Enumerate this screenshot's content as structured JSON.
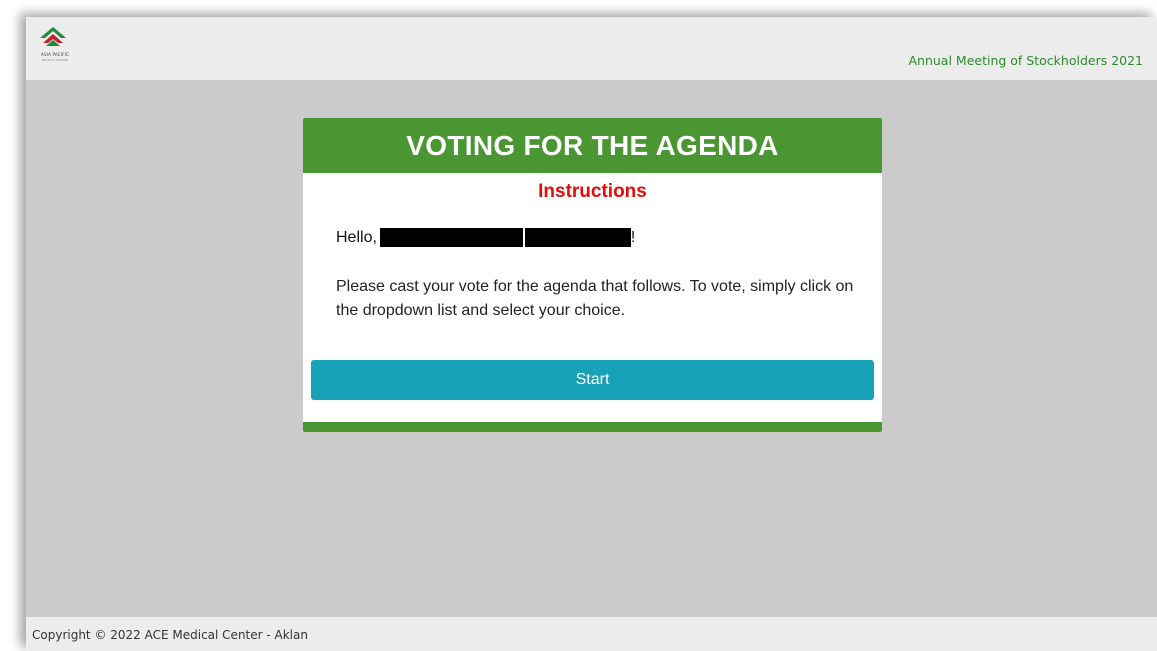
{
  "header": {
    "logo_name": "ASIA PACIFIC",
    "logo_subtitle": "MEDICAL CENTER",
    "meeting_title": "Annual Meeting of Stockholders 2021"
  },
  "card": {
    "title": "VOTING FOR THE AGENDA",
    "instructions_heading": "Instructions",
    "greeting_prefix": "Hello,",
    "greeting_suffix": "!",
    "message": "Please cast your vote for the agenda that follows. To vote, simply click on the dropdown list and select your choice.",
    "start_label": "Start"
  },
  "footer": {
    "copyright": "Copyright © 2022 ACE Medical Center - Aklan"
  },
  "colors": {
    "header_green": "#4a9632",
    "instructions_red": "#e00d0d",
    "button_teal": "#17a2b8",
    "meeting_title_green": "#2f8a2f"
  }
}
